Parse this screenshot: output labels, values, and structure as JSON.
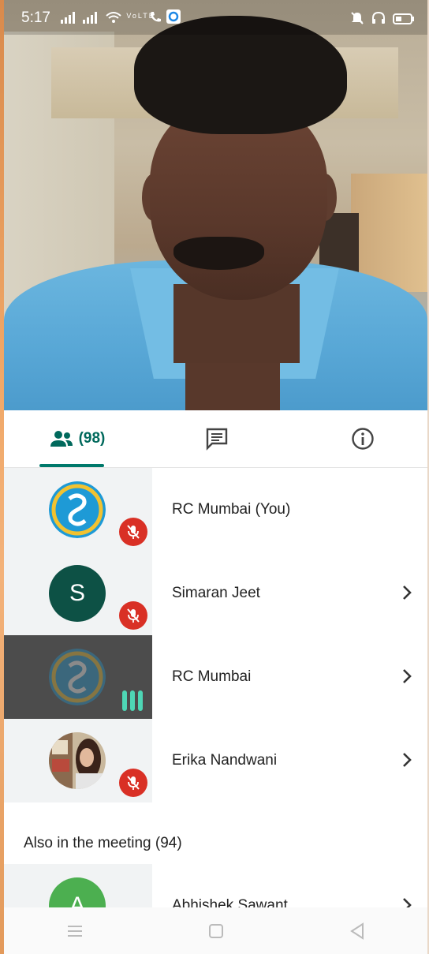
{
  "status_bar": {
    "time": "5:17",
    "carrier_badge": "VoLTE"
  },
  "colors": {
    "accent": "#00796b",
    "mute_red": "#d93025",
    "speaking_green": "#4ed6b5",
    "avatar_simaran": "#0d5145",
    "avatar_abhishek": "#4caf50"
  },
  "tabs": {
    "people_count": "(98)",
    "items": [
      {
        "name": "people",
        "icon": "people-icon",
        "active": true
      },
      {
        "name": "chat",
        "icon": "chat-icon",
        "active": false
      },
      {
        "name": "info",
        "icon": "info-icon",
        "active": false
      }
    ]
  },
  "participants": [
    {
      "name": "RC Mumbai (You)",
      "avatar": "logo",
      "muted": true,
      "chevron": false
    },
    {
      "name": "Simaran Jeet",
      "avatar_letter": "S",
      "muted": true,
      "chevron": true
    },
    {
      "name": "RC Mumbai",
      "avatar": "logo",
      "speaking": true,
      "chevron": true
    },
    {
      "name": "Erika Nandwani",
      "avatar": "photo",
      "muted": true,
      "chevron": true
    }
  ],
  "also_in_meeting": {
    "label": "Also in the meeting (94)",
    "first": {
      "name": "Abhishek Sawant",
      "avatar_letter": "A"
    }
  }
}
